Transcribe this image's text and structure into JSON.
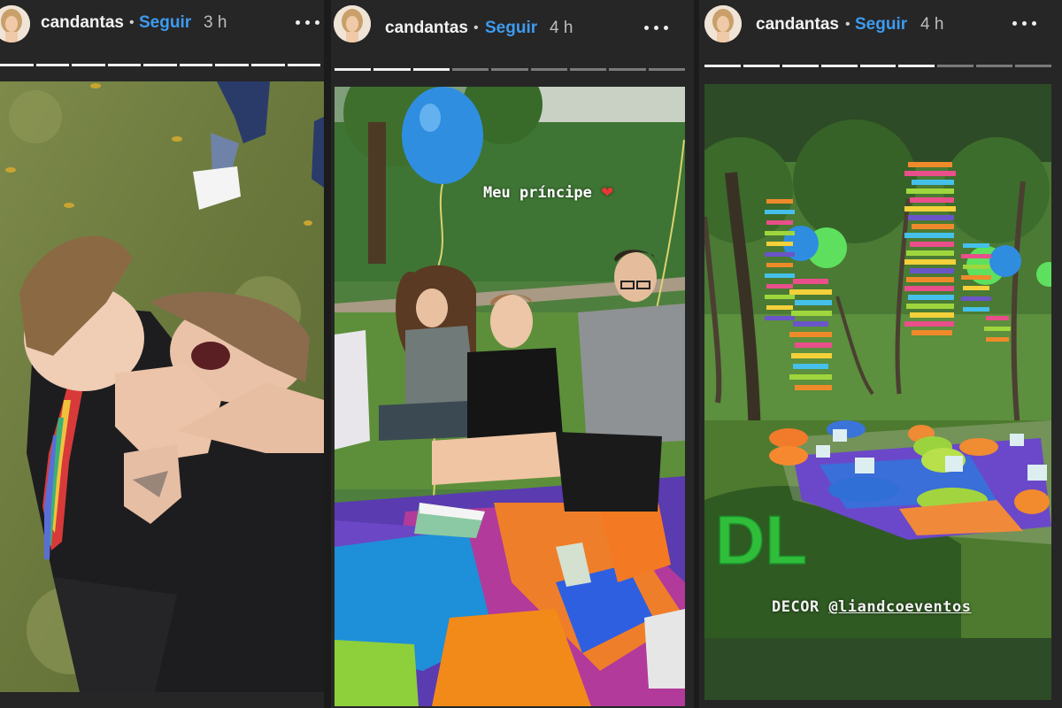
{
  "stories": [
    {
      "username": "candantas",
      "separator": "•",
      "follow_label": "Seguir",
      "time": "3 h",
      "progress_total": 9,
      "progress_viewed": 9
    },
    {
      "username": "candantas",
      "separator": "•",
      "follow_label": "Seguir",
      "time": "4 h",
      "progress_total": 9,
      "progress_viewed": 3,
      "caption": "Meu príncipe",
      "caption_emoji": "❤"
    },
    {
      "username": "candantas",
      "separator": "•",
      "follow_label": "Seguir",
      "time": "4 h",
      "progress_total": 9,
      "progress_viewed": 6,
      "decor_prefix": "DECOR",
      "decor_mention": "@liandcoeventos",
      "sign_letters": "DL"
    }
  ],
  "colors": {
    "follow": "#3d9bf0",
    "background": "#262626",
    "progress_active": "#f0f0f0",
    "progress_inactive": "#7a7a7a"
  },
  "icons": [
    "avatar",
    "more-options-icon"
  ]
}
